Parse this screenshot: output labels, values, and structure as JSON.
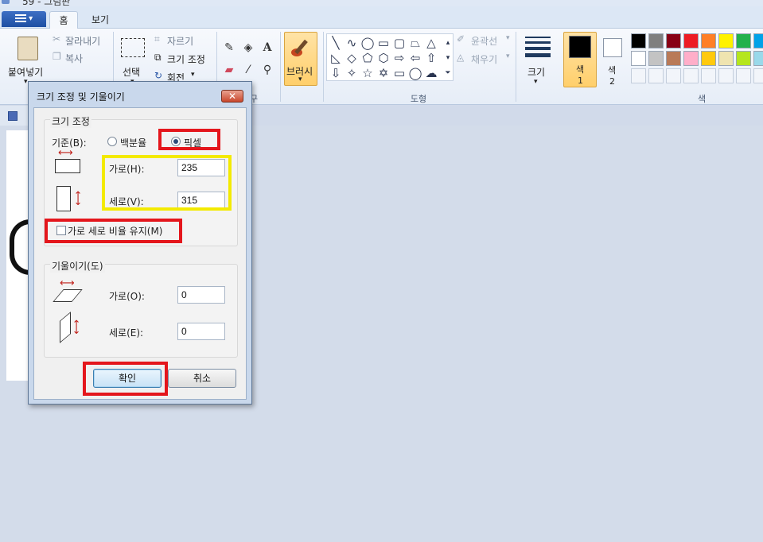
{
  "window": {
    "title": "59 - 그림판"
  },
  "tabs": [
    {
      "label": "홈",
      "active": true
    },
    {
      "label": "보기",
      "active": false
    }
  ],
  "ribbon": {
    "clipboard": {
      "paste": "붙여넣기",
      "cut": "잘라내기",
      "copy": "복사"
    },
    "image": {
      "select": "선택",
      "crop": "자르기",
      "resize": "크기 조정",
      "rotate": "회전"
    },
    "tools_group_label_fragment": "구",
    "brush": "브러시",
    "shapes": {
      "outline": "윤곽선",
      "fill": "채우기",
      "group_label": "도형"
    },
    "size": "크기",
    "color1": {
      "line1": "색",
      "line2": "1"
    },
    "color2": {
      "line1": "색",
      "line2": "2"
    },
    "colors_group_label": "색",
    "palette_row1": [
      "#000000",
      "#7f7f7f",
      "#880015",
      "#ed1c24",
      "#ff7f27",
      "#fff200",
      "#22b14c",
      "#00a2e8"
    ],
    "palette_row2": [
      "#ffffff",
      "#c3c3c3",
      "#b97a57",
      "#ffaec9",
      "#ffc90e",
      "#efe4b0",
      "#b5e61d",
      "#99d9ea"
    ]
  },
  "dialog": {
    "title": "크기 조정 및 기울이기",
    "close_label": "✕",
    "resize": {
      "legend": "크기 조정",
      "basis_label": "기준(B):",
      "option_percent": "백분율",
      "option_pixel": "픽셀",
      "selected": "픽셀",
      "horizontal_label": "가로(H):",
      "horizontal_value": "235",
      "vertical_label": "세로(V):",
      "vertical_value": "315",
      "keep_ratio_label": "가로 세로 비율 유지(M)",
      "keep_ratio_checked": false
    },
    "skew": {
      "legend": "기울이기(도)",
      "horizontal_label": "가로(O):",
      "horizontal_value": "0",
      "vertical_label": "세로(E):",
      "vertical_value": "0"
    },
    "ok_label": "확인",
    "cancel_label": "취소"
  },
  "highlights": {
    "red": "#e4161c",
    "yellow": "#f3ea00"
  }
}
